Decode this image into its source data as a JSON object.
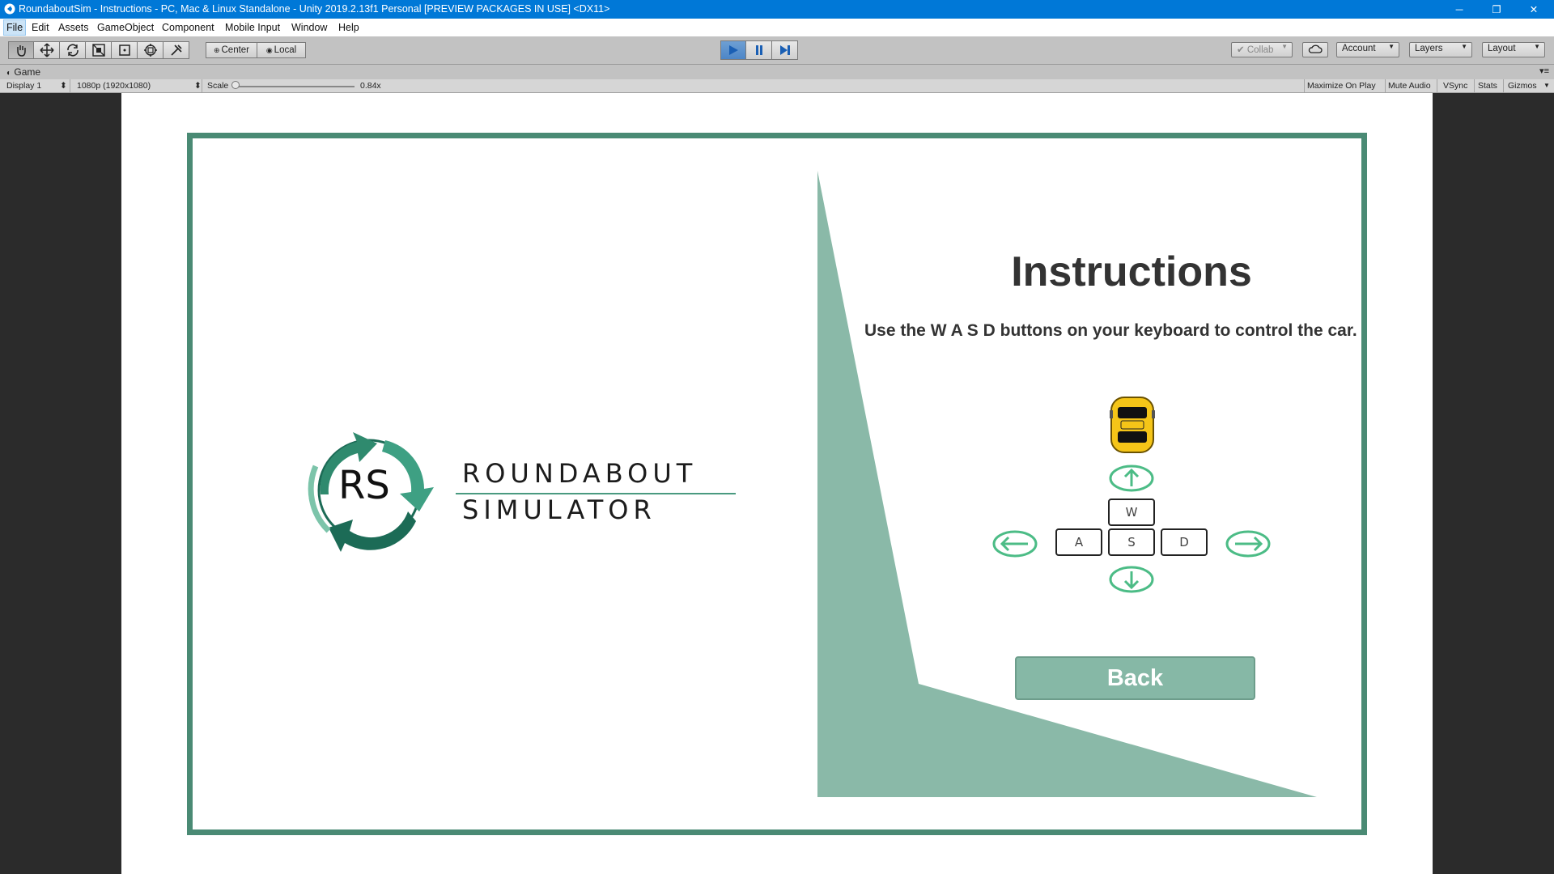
{
  "window": {
    "title": "RoundaboutSim - Instructions - PC, Mac & Linux Standalone - Unity 2019.2.13f1 Personal [PREVIEW PACKAGES IN USE] <DX11>",
    "controls": {
      "minimize": "─",
      "restore": "❐",
      "close": "✕"
    }
  },
  "menu": [
    "File",
    "Edit",
    "Assets",
    "GameObject",
    "Component",
    "Mobile Input",
    "Window",
    "Help"
  ],
  "toolbar": {
    "tools": [
      "hand-icon",
      "move-icon",
      "rotate-icon",
      "scale-icon",
      "rect-icon",
      "transform-icon",
      "custom-tool-icon"
    ],
    "pivot": "Center",
    "space": "Local",
    "collab": "Collab",
    "account": "Account",
    "layers": "Layers",
    "layout": "Layout"
  },
  "game_tab": {
    "label": "Game"
  },
  "game_bar": {
    "display": "Display 1",
    "resolution": "1080p (1920x1080)",
    "scale_label": "Scale",
    "scale_value": "0.84x",
    "scale_fraction": 0.0,
    "maximize": "Maximize On Play",
    "mute": "Mute Audio",
    "vsync": "VSync",
    "stats": "Stats",
    "gizmos": "Gizmos"
  },
  "game": {
    "logo": {
      "emblem_letters": "RS",
      "line1": "ROUNDABOUT",
      "line2": "SIMULATOR"
    },
    "title": "Instructions",
    "text": "Use the W A S D buttons on your keyboard to control the car.",
    "keys": {
      "w": "W",
      "a": "A",
      "s": "S",
      "d": "D"
    },
    "back": "Back"
  },
  "colors": {
    "accent": "#4a8a74",
    "panel": "#8ab9a8",
    "button": "#86b8a6",
    "car": "#f5c518",
    "arrow": "#4cbc86"
  }
}
